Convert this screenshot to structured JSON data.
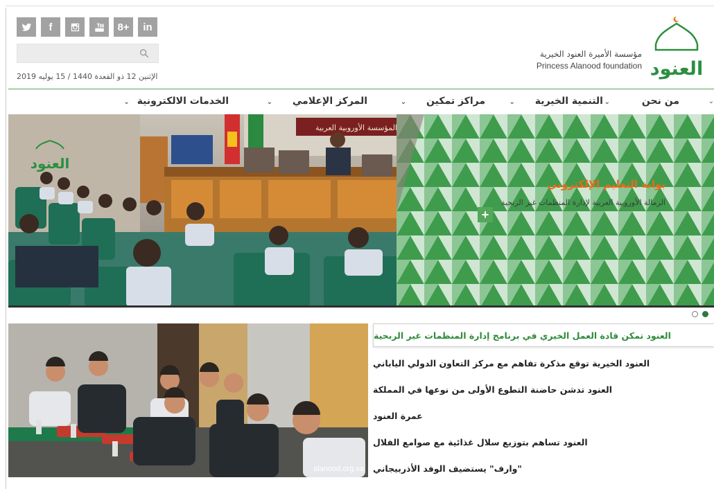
{
  "header": {
    "social": [
      {
        "icon": "twitter-icon",
        "glyph": ""
      },
      {
        "icon": "facebook-icon",
        "glyph": "f"
      },
      {
        "icon": "instagram-icon",
        "glyph": ""
      },
      {
        "icon": "youtube-icon",
        "glyph": ""
      },
      {
        "icon": "google-plus-icon",
        "glyph": "8+"
      },
      {
        "icon": "linkedin-icon",
        "glyph": "in"
      }
    ],
    "search": {
      "placeholder": "",
      "value": ""
    },
    "date": "الإثنين 12 ذو القعدة 1440 / 15 يوليه 2019",
    "brand_ar": "مؤسسة الأميرة العنود الخيرية",
    "brand_en": "Princess Alanood foundation",
    "logo_text": "العنود"
  },
  "nav": {
    "items": [
      {
        "label": "من نحن"
      },
      {
        "label": "التنمية الخيرية"
      },
      {
        "label": "مراكز تمكين"
      },
      {
        "label": "المركز الإعلامي"
      },
      {
        "label": "الخدمات الالكترونية"
      }
    ]
  },
  "slider": {
    "title": "بوابة التعليم الإلكتروني",
    "subtitle": "الزمالة الأوروبية العربية لإدارة المنظمات غير الربحية",
    "plus": "+",
    "banner_text": "المؤسسة الأوروبية العربية",
    "logo_text": "العنود",
    "dots": 2,
    "active_dot": 1
  },
  "news": {
    "photo_watermark": "alanood.org.sa",
    "items": [
      {
        "title": "العنود تمكن قادة العمل الخيري في برنامج إدارة المنظمات غير الربحية",
        "active": true
      },
      {
        "title": "العنود الخيرية توقع مذكرة تفاهم مع مركز التعاون الدولي الياباني",
        "active": false
      },
      {
        "title": "العنود تدشن حاضنة التطوع الأولى من نوعها في المملكة",
        "active": false
      },
      {
        "title": "عمرة العنود",
        "active": false
      },
      {
        "title": "العنود تساهم بتوزيع سلال غذائية مع صوامع الفلال",
        "active": false
      },
      {
        "title": "\"وارف\" يستضيف الوفد الأذربيجاني",
        "active": false
      }
    ]
  },
  "colors": {
    "brand_green": "#2b8f3f",
    "accent_orange": "#ea6a18",
    "social_gray": "#a2a2a2"
  }
}
